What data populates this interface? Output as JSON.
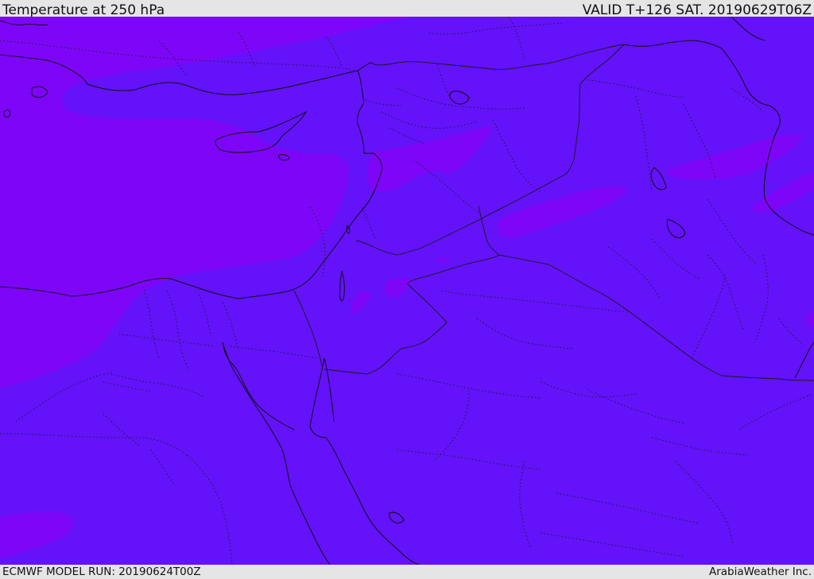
{
  "header": {
    "title": "Temperature at 250 hPa",
    "valid": "VALID T+126 SAT. 20190629T06Z"
  },
  "footer": {
    "model_run": "ECMWF MODEL RUN: 20190624T00Z",
    "credit": "ArabiaWeather Inc."
  },
  "colors": {
    "base_field": "#6312fa",
    "cold_field": "#7d06f8",
    "coastline": "#111111",
    "border": "#222222"
  }
}
